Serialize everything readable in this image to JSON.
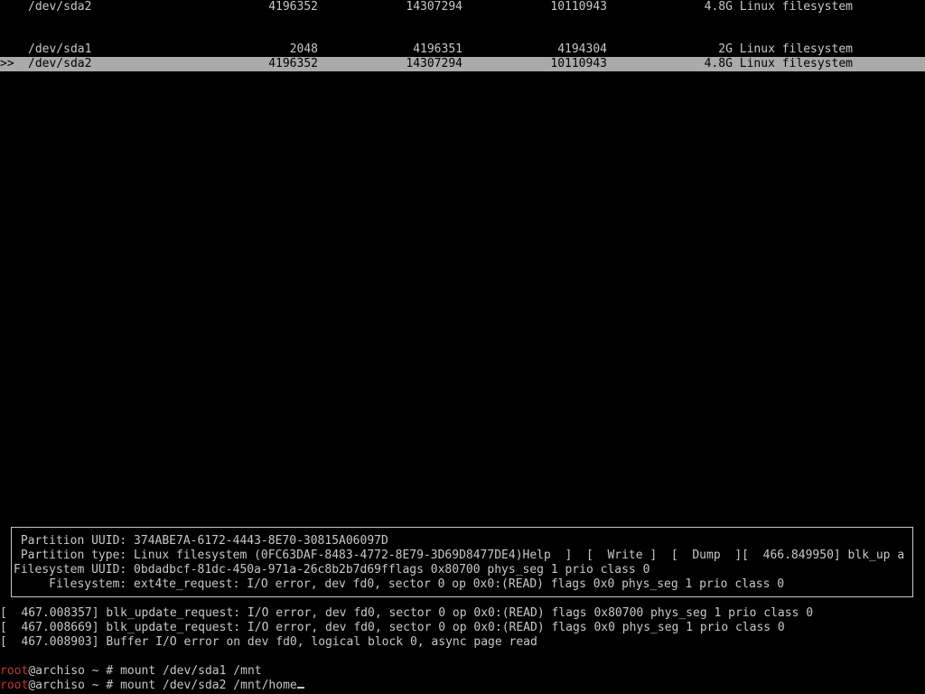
{
  "partition_rows": [
    {
      "marker": "",
      "device": "/dev/sda2",
      "start": "4196352",
      "end": "14307294",
      "sectors": "10110943",
      "size_type": "4.8G Linux filesystem"
    },
    {
      "marker": "",
      "device": "/dev/sda1",
      "start": "2048",
      "end": "4196351",
      "sectors": "4194304",
      "size_type": "2G Linux filesystem"
    },
    {
      "marker": ">>",
      "device": "/dev/sda2",
      "start": "4196352",
      "end": "14307294",
      "sectors": "10110943",
      "size_type": "4.8G Linux filesystem"
    }
  ],
  "info_box": [
    " Partition UUID: 374ABE7A-6172-4443-8E70-30815A06097D",
    " Partition type: Linux filesystem (0FC63DAF-8483-4772-8E79-3D69D8477DE4)Help  ]  [  Write ]  [  Dump  ][  466.849950] blk_up a",
    "Filesystem UUID: 0bdadbcf-81dc-450a-971a-26c8b2b7d69fflags 0x80700 phys_seg 1 prio class 0",
    "     Filesystem: ext4te_request: I/O error, dev fd0, sector 0 op 0x0:(READ) flags 0x0 phys_seg 1 prio class 0"
  ],
  "kernel_log": [
    "[  467.008357] blk_update_request: I/O error, dev fd0, sector 0 op 0x0:(READ) flags 0x80700 phys_seg 1 prio class 0",
    "[  467.008669] blk_update_request: I/O error, dev fd0, sector 0 op 0x0:(READ) flags 0x0 phys_seg 1 prio class 0",
    "[  467.008903] Buffer I/O error on dev fd0, logical block 0, async page read"
  ],
  "prompt": {
    "user": "root",
    "host_path": "@archiso ~ # ",
    "commands": [
      "mount /dev/sda1 /mnt",
      "mount /dev/sda2 /mnt/home"
    ]
  },
  "colors": {
    "background": "#000000",
    "text": "#c8c8c8",
    "highlight": "#aaaaaa",
    "user": "#c0392b"
  }
}
